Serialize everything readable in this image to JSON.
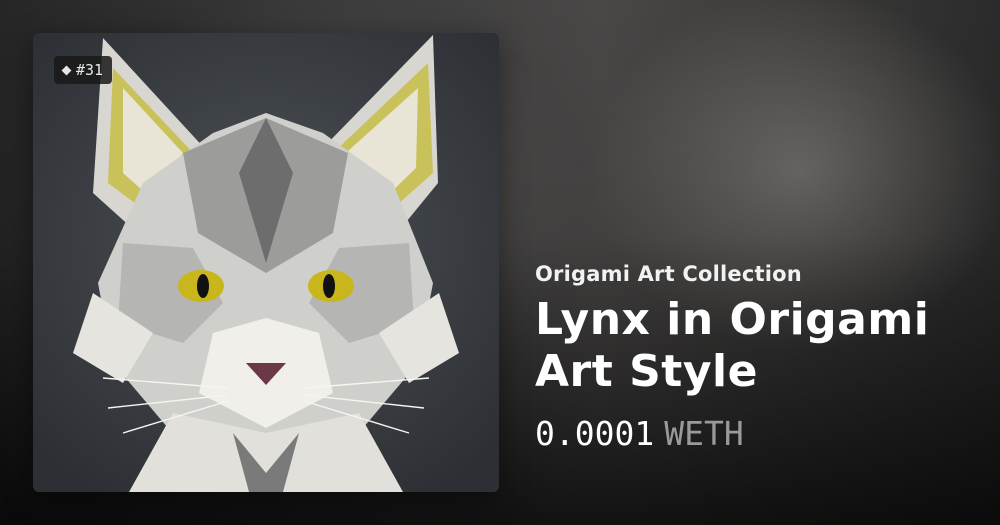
{
  "token": {
    "number": "#31",
    "icon": "diamond-icon"
  },
  "collection": "Origami Art Collection",
  "title": "Lynx in Origami Art Style",
  "price": {
    "amount": "0.0001",
    "currency": "WETH"
  },
  "colors": {
    "title": "#ffffff",
    "currency": "#9a9a9a",
    "eyes": "#c9b61c",
    "card_background": "#3b3f44"
  }
}
